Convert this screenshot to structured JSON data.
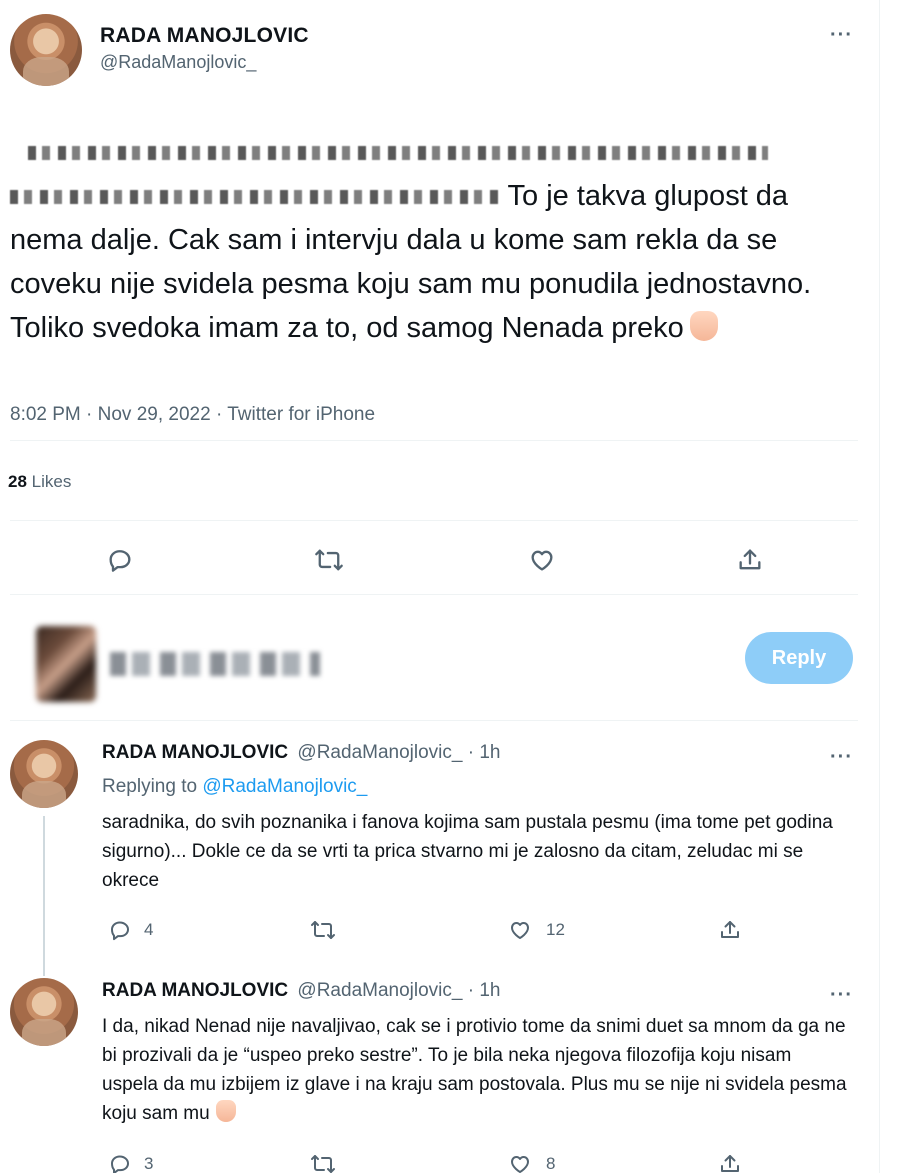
{
  "main_tweet": {
    "display_name": "RADA MANOJLOVIC",
    "handle": "@RadaManojlovic_",
    "text_visible": "To je takva glupost da nema dalje. Cak sam i intervju dala u kome sam rekla da se coveku nije svidela pesma koju sam mu ponudila jednostavno. Toliko svedoka imam za to, od samog Nenada preko",
    "timestamp": "8:02 PM · Nov 29, 2022 · Twitter for iPhone",
    "likes_count": "28",
    "likes_label": "Likes",
    "icons": [
      "reply-icon",
      "retweet-icon",
      "like-icon",
      "share-icon"
    ]
  },
  "composer": {
    "reply_button": "Reply"
  },
  "replies": [
    {
      "display_name": "RADA MANOJLOVIC",
      "handle_time": "@RadaManojlovic_ · 1h",
      "replying_prefix": "Replying to",
      "replying_handle": "@RadaManojlovic_",
      "text": "saradnika, do svih poznanika i fanova kojima sam pustala pesmu (ima tome pet godina sigurno)... Dokle ce da se vrti ta prica stvarno mi je zalosno da citam, zeludac mi se okrece",
      "reply_count": "4",
      "retweet_count": "",
      "like_count": "12"
    },
    {
      "display_name": "RADA MANOJLOVIC",
      "handle_time": "@RadaManojlovic_ · 1h",
      "text": "I da, nikad Nenad nije navaljivao, cak se i protivio tome da snimi duet sa mnom da ga ne bi prozivali da je “uspeo preko sestre”. To je bila neka njegova filozofija koju nisam uspela da mu izbijem iz glave i na kraju sam postovala. Plus mu se nije ni svidela pesma koju sam mu",
      "reply_count": "3",
      "retweet_count": "",
      "like_count": "8"
    }
  ],
  "more_label": "···"
}
